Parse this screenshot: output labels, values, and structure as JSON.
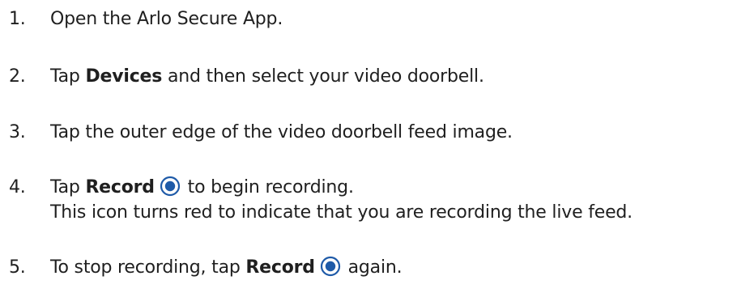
{
  "colors": {
    "text": "#1f1f1f",
    "record_icon": "#1e5aa8",
    "background": "#ffffff"
  },
  "steps": [
    {
      "number": "1.",
      "text": "Open the Arlo Secure App."
    },
    {
      "number": "2.",
      "before": "Tap ",
      "bold": "Devices",
      "after": " and then select your video doorbell."
    },
    {
      "number": "3.",
      "text": "Tap the outer edge of the video doorbell feed image."
    },
    {
      "number": "4.",
      "before": "Tap ",
      "bold": "Record",
      "after": " to begin recording.",
      "icon": "record-icon",
      "line2": "This icon turns red to indicate that you are recording the live feed."
    },
    {
      "number": "5.",
      "before": "To stop recording, tap ",
      "bold": "Record",
      "after": " again.",
      "icon": "record-icon"
    }
  ]
}
